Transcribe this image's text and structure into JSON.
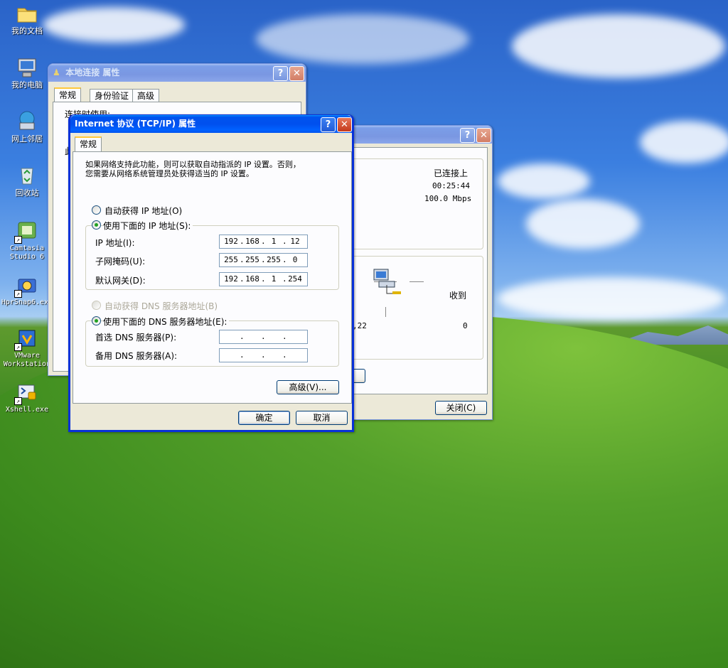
{
  "desktop": {
    "icons": [
      {
        "label": "我的文档",
        "icon": "folder-icon"
      },
      {
        "label": "我的电脑",
        "icon": "computer-icon"
      },
      {
        "label": "网上邻居",
        "icon": "network-icon"
      },
      {
        "label": "回收站",
        "icon": "recycle-bin-icon"
      },
      {
        "label": "Camtasia Studio 6",
        "icon": "camtasia-icon"
      },
      {
        "label": "HprSnap6.exe",
        "icon": "hypersnap-icon"
      },
      {
        "label": "VMware Workstation",
        "icon": "vmware-icon"
      },
      {
        "label": "Xshell.exe",
        "icon": "xshell-icon"
      }
    ]
  },
  "conn_props_window": {
    "title": "本地连接 属性",
    "tabs": [
      "常规",
      "身份验证",
      "高级"
    ],
    "partial_text_1": "连接时使用:",
    "partial_text_2": "此"
  },
  "status_window": {
    "status_value": "已连接上",
    "duration_value": "00:25:44",
    "speed_value": "100.0 Mbps",
    "received_label": "收到",
    "sent_partial": ",22",
    "received_value": "0",
    "close_button": "关闭(C)"
  },
  "tcpip_window": {
    "title": "Internet 协议 (TCP/IP) 属性",
    "tab": "常规",
    "description": [
      "如果网络支持此功能，则可以获取自动指派的 IP 设置。否则，",
      "您需要从网络系统管理员处获得适当的 IP 设置。"
    ],
    "auto_ip_label": "自动获得 IP 地址(O)",
    "use_ip_label": "使用下面的 IP 地址(S):",
    "ip_label": "IP 地址(I):",
    "mask_label": "子网掩码(U):",
    "gateway_label": "默认网关(D):",
    "ip_address": [
      "192",
      "168",
      "1",
      "12"
    ],
    "subnet_mask": [
      "255",
      "255",
      "255",
      "0"
    ],
    "gateway": [
      "192",
      "168",
      "1",
      "254"
    ],
    "auto_dns_label": "自动获得 DNS 服务器地址(B)",
    "use_dns_label": "使用下面的 DNS 服务器地址(E):",
    "preferred_dns_label": "首选 DNS 服务器(P):",
    "alternate_dns_label": "备用 DNS 服务器(A):",
    "ip_mode": "manual",
    "dns_mode": "manual",
    "advanced_button": "高级(V)...",
    "ok_button": "确定",
    "cancel_button": "取消"
  }
}
